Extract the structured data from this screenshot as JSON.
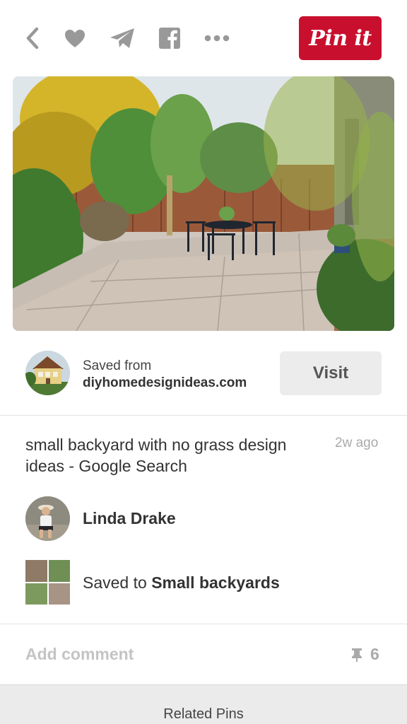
{
  "toolbar": {
    "back_icon": "chevron-left-icon",
    "like_icon": "heart-icon",
    "send_icon": "paper-plane-icon",
    "facebook_icon": "facebook-icon",
    "more_icon": "more-dots-icon",
    "pin_label": "Pin it",
    "pin_color": "#c8102e"
  },
  "source": {
    "saved_from": "Saved from",
    "domain": "diyhomedesignideas.com",
    "visit_label": "Visit"
  },
  "pin": {
    "description": "small backyard with no grass design ideas - Google Search",
    "time": "2w ago"
  },
  "user": {
    "name": "Linda Drake"
  },
  "board": {
    "prefix": "Saved to ",
    "name": "Small backyards"
  },
  "footer": {
    "comment_label": "Add comment",
    "repin_icon": "pushpin-icon",
    "repin_count": "6",
    "related_label": "Related Pins"
  }
}
